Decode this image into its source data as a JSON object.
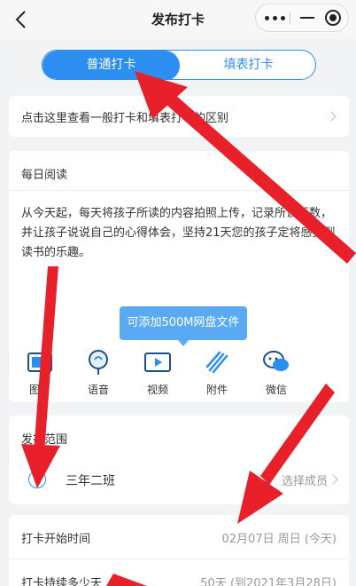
{
  "nav": {
    "title": "发布打卡"
  },
  "tabs": [
    {
      "label": "普通打卡",
      "active": true
    },
    {
      "label": "填表打卡",
      "active": false
    }
  ],
  "notice": {
    "text": "点击这里查看一般打卡和填表打卡的区别"
  },
  "task": {
    "title": "每日阅读",
    "content": "从今天起，每天将孩子所读的内容拍照上传，记录所读页数，并让孩子说说自己的心得体会，坚持21天您的孩子定将感受到读书的乐趣。"
  },
  "tooltip": {
    "text": "可添加500M网盘文件"
  },
  "tools": [
    {
      "label": "图片",
      "icon": "image-icon"
    },
    {
      "label": "语音",
      "icon": "mic-icon"
    },
    {
      "label": "视频",
      "icon": "video-icon"
    },
    {
      "label": "附件",
      "icon": "paperclip-icon"
    },
    {
      "label": "微信",
      "icon": "wechat-icon"
    }
  ],
  "scope": {
    "title": "发布范围",
    "class_name": "三年二班",
    "select_members": "选择成员"
  },
  "schedule": {
    "start_label": "打卡开始时间",
    "start_value": "02月07日 周日 (今天)",
    "duration_label": "打卡持续多少天",
    "duration_value": "50天 (到2021年3月28日)"
  },
  "colors": {
    "accent": "#2b8ef0",
    "arrow": "#e8202a"
  }
}
